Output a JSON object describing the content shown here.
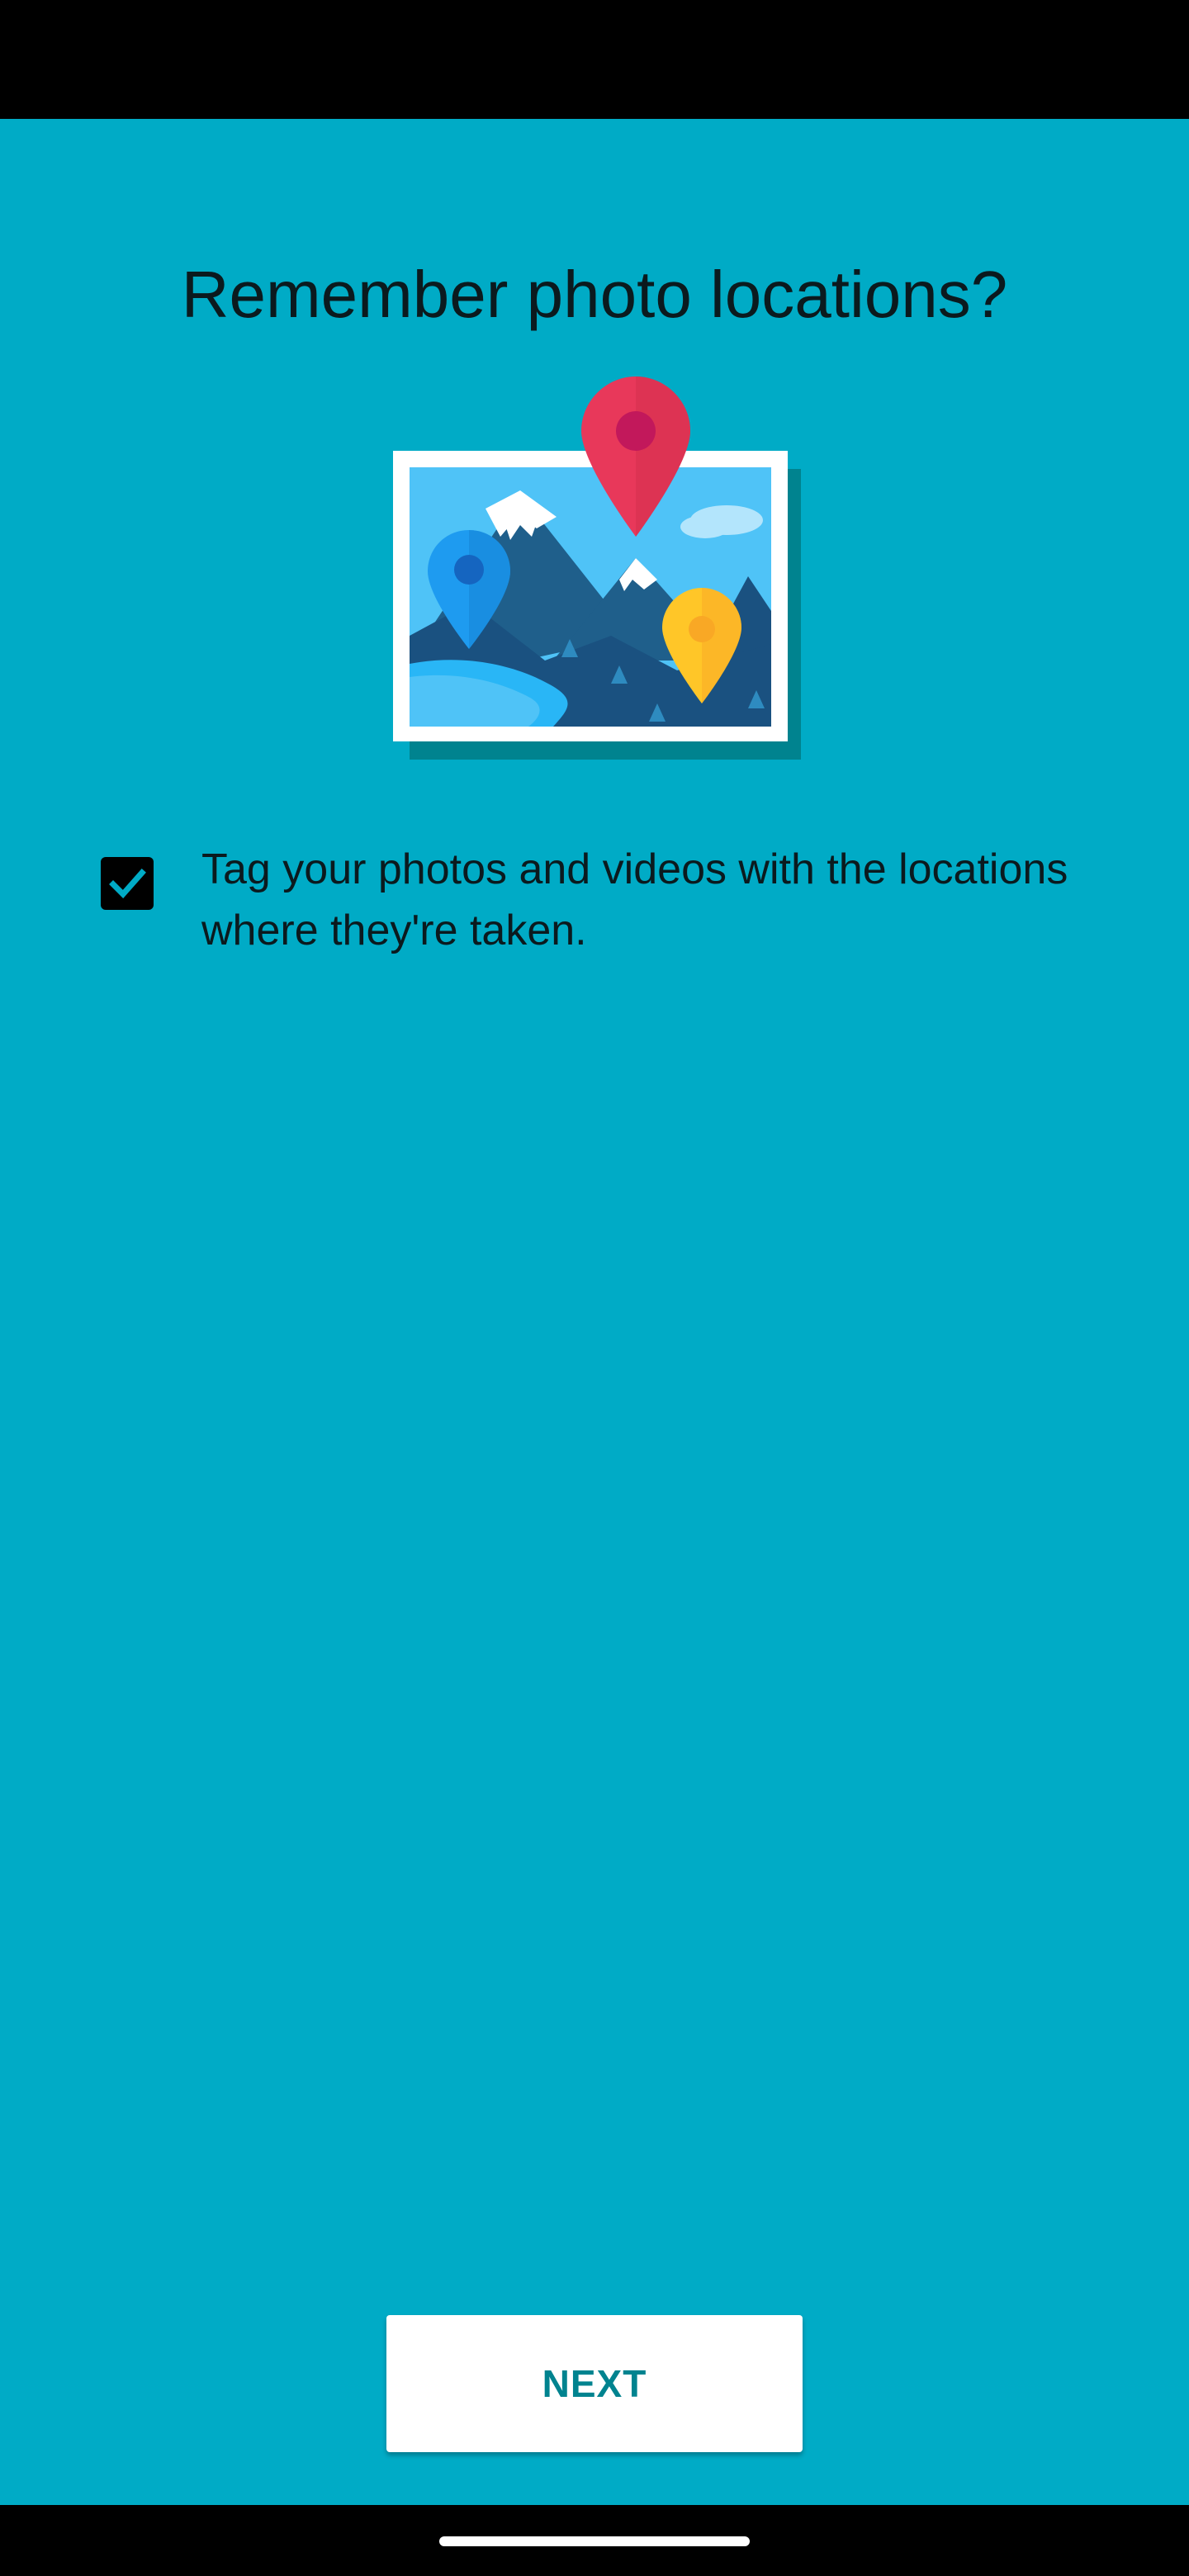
{
  "page": {
    "title": "Remember photo locations?",
    "checkbox": {
      "checked": true,
      "label": "Tag your photos and videos with the locations where they're taken."
    },
    "next_button": {
      "label": "NEXT"
    }
  },
  "icons": {
    "illustration": "photo-with-location-pins-icon",
    "checkbox_check": "checkmark-icon",
    "home": "home-gesture-pill"
  },
  "colors": {
    "background": "#00ABC6",
    "status_bar": "#000000",
    "nav_bar": "#000000",
    "button_background": "#FFFFFF",
    "button_text": "#00838F",
    "pin_red": "#E8385A",
    "pin_blue": "#1E9BF0",
    "pin_yellow": "#FFC628"
  }
}
